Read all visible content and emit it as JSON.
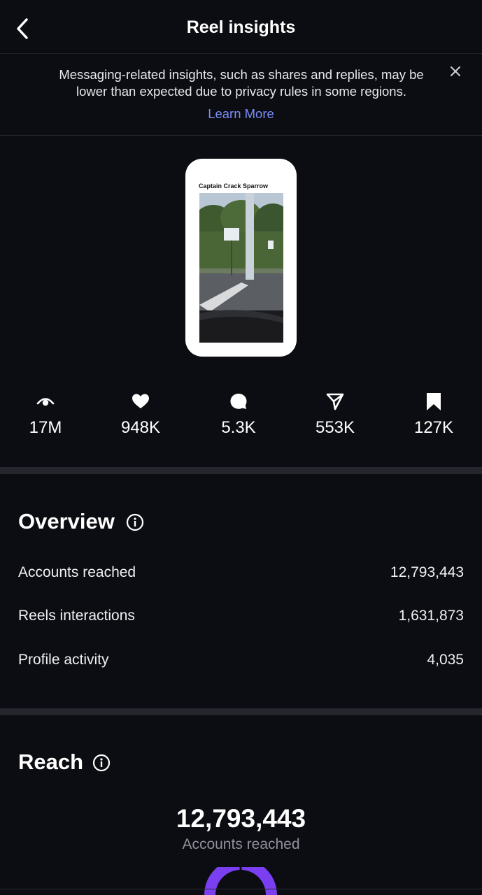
{
  "header": {
    "title": "Reel insights",
    "back_icon": "chevron-left-icon"
  },
  "notice": {
    "text": "Messaging-related insights, such as shares and replies, may be lower than expected due to privacy rules in some regions.",
    "link_label": "Learn More",
    "close_icon": "close-icon",
    "link_color": "#7a8cf5"
  },
  "reel": {
    "caption": "Captain Crack Sparrow"
  },
  "stats": [
    {
      "icon": "eye-icon",
      "value": "17M"
    },
    {
      "icon": "heart-icon",
      "value": "948K"
    },
    {
      "icon": "comment-icon",
      "value": "5.3K"
    },
    {
      "icon": "share-icon",
      "value": "553K"
    },
    {
      "icon": "bookmark-icon",
      "value": "127K"
    }
  ],
  "overview": {
    "title": "Overview",
    "info_icon": "info-icon",
    "rows": [
      {
        "label": "Accounts reached",
        "value": "12,793,443"
      },
      {
        "label": "Reels interactions",
        "value": "1,631,873"
      },
      {
        "label": "Profile activity",
        "value": "4,035"
      }
    ]
  },
  "reach": {
    "title": "Reach",
    "info_icon": "info-icon",
    "total": "12,793,443",
    "total_label": "Accounts reached",
    "donut_color": "#7b3ff2"
  },
  "colors": {
    "background": "#0c0d12",
    "divider": "#25262d",
    "accent": "#7b3ff2"
  }
}
